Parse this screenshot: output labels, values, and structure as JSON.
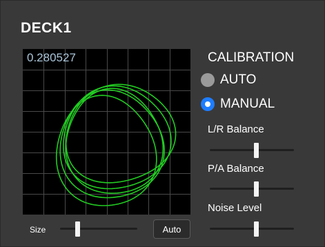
{
  "deck": {
    "title": "DECK1"
  },
  "scope": {
    "value": "0.280527",
    "trace_color": "#22cc22",
    "grid_color": "#4a4a4a",
    "size_label": "Size",
    "size_level": 0.22,
    "auto_label": "Auto"
  },
  "calibration": {
    "title": "CALIBRATION",
    "options": [
      {
        "label": "AUTO",
        "selected": false
      },
      {
        "label": "MANUAL",
        "selected": true
      }
    ],
    "accent": "#1e7dff",
    "controls": [
      {
        "label": "L/R Balance",
        "level": 0.55
      },
      {
        "label": "P/A Balance",
        "level": 0.55
      },
      {
        "label": "Noise Level",
        "level": 0.55
      }
    ]
  }
}
